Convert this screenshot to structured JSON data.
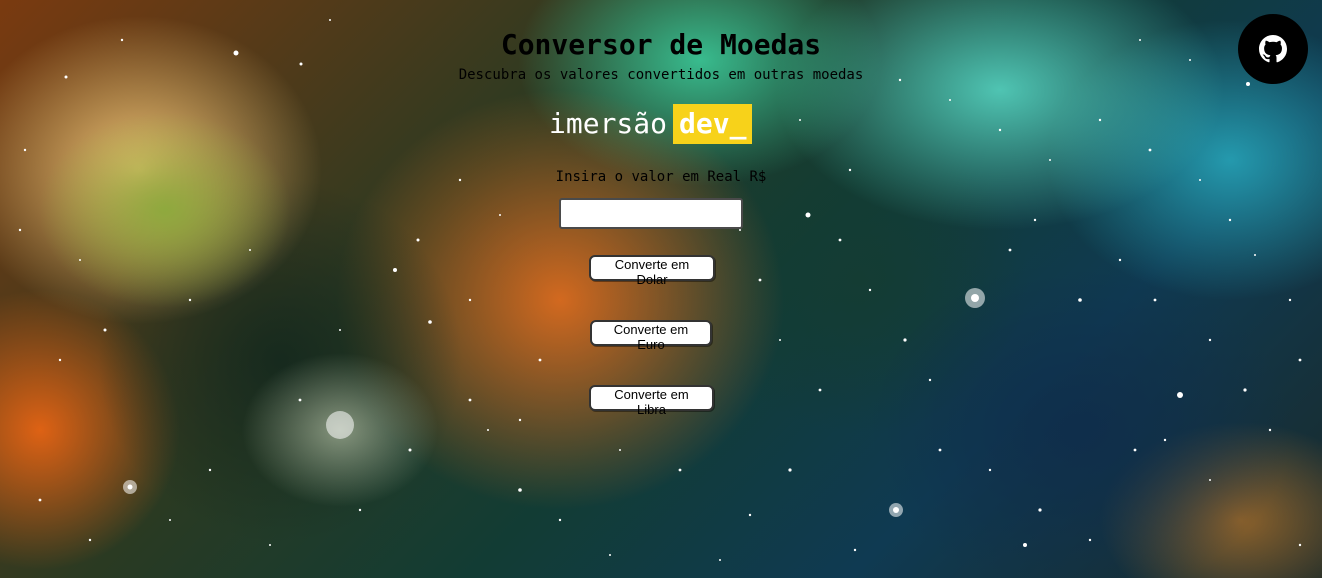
{
  "header": {
    "title": "Conversor de Moedas",
    "subtitle": "Descubra os valores convertidos em outras moedas"
  },
  "logo": {
    "part1": "imersão",
    "part2": "dev_",
    "accent_color": "#f7d21a"
  },
  "form": {
    "prompt_label": "Insira o valor em Real R$",
    "input_value": "",
    "input_placeholder": ""
  },
  "buttons": {
    "dolar_label": "Converte em Dolar",
    "euro_label": "Converte em Euro",
    "libra_label": "Converte em Libra"
  },
  "corner_link": {
    "icon": "github-icon",
    "background_color": "#000000"
  }
}
